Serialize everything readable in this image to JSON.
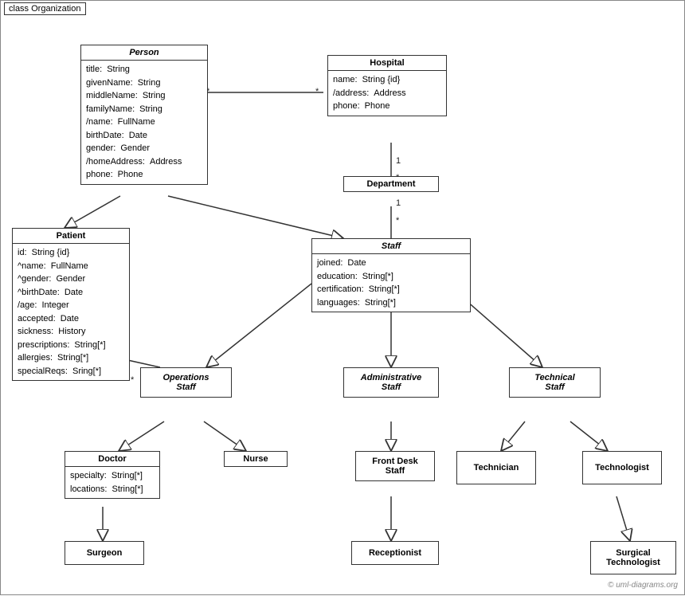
{
  "diagram": {
    "title": "class Organization",
    "watermark": "© uml-diagrams.org",
    "boxes": {
      "person": {
        "title": "Person",
        "italic": true,
        "attrs": [
          [
            "title:",
            "String"
          ],
          [
            "givenName:",
            "String"
          ],
          [
            "middleName:",
            "String"
          ],
          [
            "familyName:",
            "String"
          ],
          [
            "/name:",
            "FullName"
          ],
          [
            "birthDate:",
            "Date"
          ],
          [
            "gender:",
            "Gender"
          ],
          [
            "/homeAddress:",
            "Address"
          ],
          [
            "phone:",
            "Phone"
          ]
        ]
      },
      "hospital": {
        "title": "Hospital",
        "italic": false,
        "attrs": [
          [
            "name:",
            "String {id}"
          ],
          [
            "/address:",
            "Address"
          ],
          [
            "phone:",
            "Phone"
          ]
        ]
      },
      "department": {
        "title": "Department",
        "italic": false,
        "attrs": []
      },
      "staff": {
        "title": "Staff",
        "italic": true,
        "attrs": [
          [
            "joined:",
            "Date"
          ],
          [
            "education:",
            "String[*]"
          ],
          [
            "certification:",
            "String[*]"
          ],
          [
            "languages:",
            "String[*]"
          ]
        ]
      },
      "patient": {
        "title": "Patient",
        "italic": false,
        "attrs": [
          [
            "id:",
            "String {id}"
          ],
          [
            "^name:",
            "FullName"
          ],
          [
            "^gender:",
            "Gender"
          ],
          [
            "^birthDate:",
            "Date"
          ],
          [
            "/age:",
            "Integer"
          ],
          [
            "accepted:",
            "Date"
          ],
          [
            "sickness:",
            "History"
          ],
          [
            "prescriptions:",
            "String[*]"
          ],
          [
            "allergies:",
            "String[*]"
          ],
          [
            "specialReqs:",
            "Sring[*]"
          ]
        ]
      },
      "operations_staff": {
        "title": "Operations Staff",
        "italic": true,
        "attrs": []
      },
      "administrative_staff": {
        "title": "Administrative Staff",
        "italic": true,
        "attrs": []
      },
      "technical_staff": {
        "title": "Technical Staff",
        "italic": true,
        "attrs": []
      },
      "doctor": {
        "title": "Doctor",
        "italic": false,
        "attrs": [
          [
            "specialty:",
            "String[*]"
          ],
          [
            "locations:",
            "String[*]"
          ]
        ]
      },
      "nurse": {
        "title": "Nurse",
        "italic": false,
        "attrs": []
      },
      "front_desk_staff": {
        "title": "Front Desk Staff",
        "italic": false,
        "attrs": []
      },
      "technician": {
        "title": "Technician",
        "italic": false,
        "attrs": []
      },
      "technologist": {
        "title": "Technologist",
        "italic": false,
        "attrs": []
      },
      "surgeon": {
        "title": "Surgeon",
        "italic": false,
        "attrs": []
      },
      "receptionist": {
        "title": "Receptionist",
        "italic": false,
        "attrs": []
      },
      "surgical_technologist": {
        "title": "Surgical Technologist",
        "italic": false,
        "attrs": []
      }
    }
  }
}
